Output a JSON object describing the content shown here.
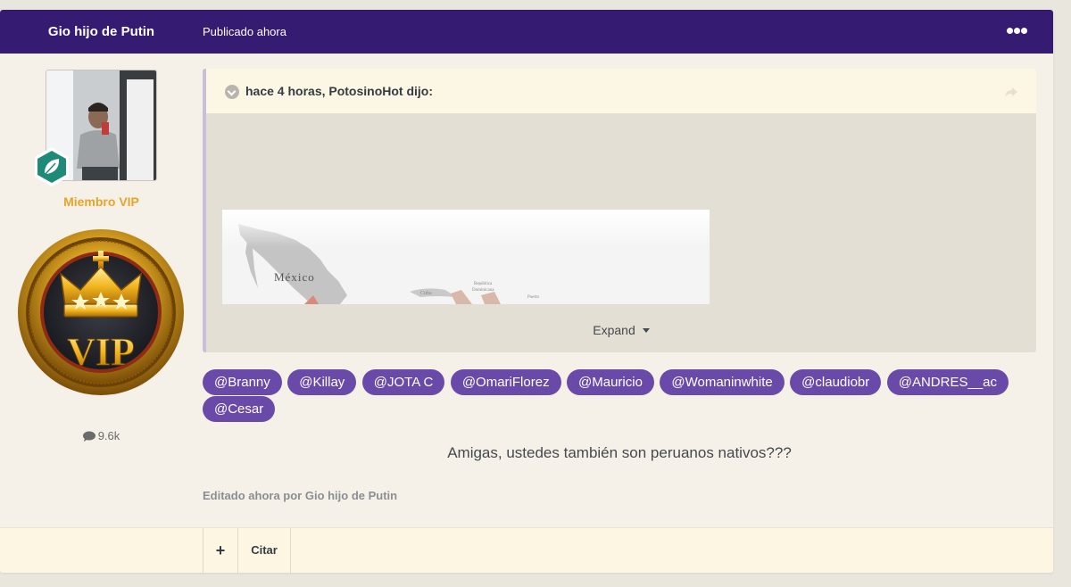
{
  "header": {
    "author": "Gio hijo de Putin",
    "published": "Publicado ahora"
  },
  "author_panel": {
    "group": "Miembro VIP",
    "badge_text": "VIP",
    "post_count": "9.6k"
  },
  "quote": {
    "cite": "hace 4 horas, PotosinoHot dijo:",
    "map_labels": [
      "México",
      "Cuba",
      "República",
      "Dominicana",
      "Puerto"
    ],
    "expand_label": "Expand"
  },
  "mentions": [
    "@Branny",
    "@Killay",
    "@JOTA C",
    "@OmariFlorez",
    "@Mauricio",
    "@Womaninwhite",
    "@claudiobr",
    "@ANDRES__ac",
    "@Cesar"
  ],
  "body": "Amigas, ustedes también son peruanos nativos???",
  "edited": "Editado ahora por Gio hijo de Putin",
  "footer": {
    "plus": "+",
    "cite": "Citar"
  },
  "colors": {
    "header_bg": "#361b73",
    "mention_bg": "#6a4aa8",
    "group_color": "#e7a426"
  }
}
